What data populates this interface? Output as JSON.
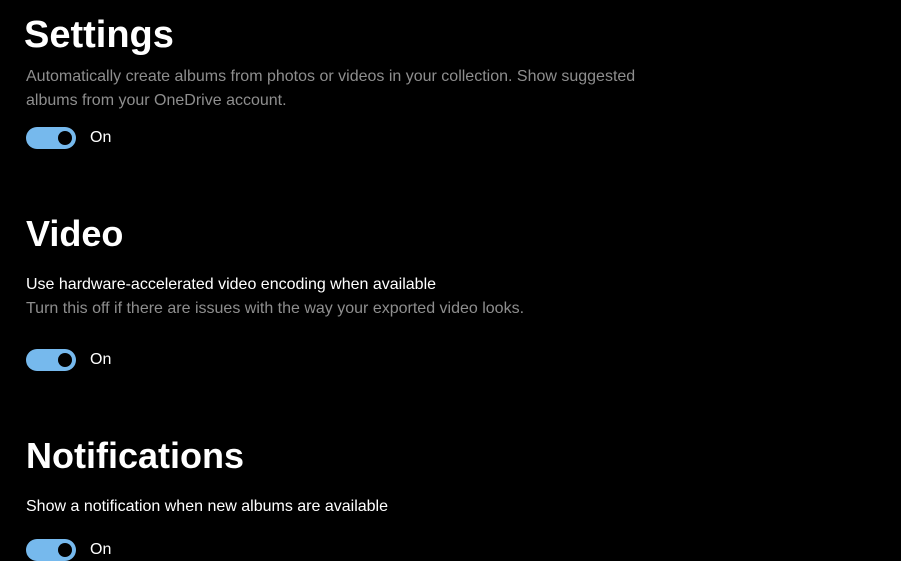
{
  "header": {
    "title": "Settings"
  },
  "sections": {
    "albums": {
      "description_line1": "Automatically create albums from photos or videos in your collection. Show suggested",
      "description_line2": "albums from your OneDrive account.",
      "toggle_state": "On"
    },
    "video": {
      "heading": "Video",
      "title": "Use hardware-accelerated video encoding when available",
      "description": "Turn this off if there are issues with the way your exported video looks.",
      "toggle_state": "On"
    },
    "notifications": {
      "heading": "Notifications",
      "title": "Show a notification when new albums are available",
      "toggle_state": "On"
    }
  }
}
